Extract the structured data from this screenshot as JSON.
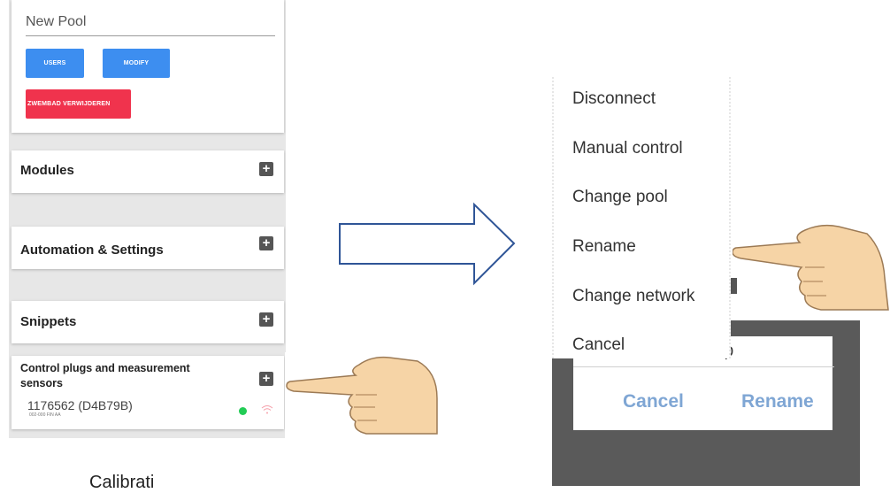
{
  "left_panel": {
    "pool": {
      "name": "New Pool",
      "users_button": "USERS",
      "modify_button": "MODIFY",
      "delete_button": "ZWEMBAD VERWIJDEREN"
    },
    "sections": [
      {
        "title": "Modules"
      },
      {
        "title": "Automation & Settings"
      },
      {
        "title": "Snippets"
      },
      {
        "title": "Control plugs and measurement sensors"
      }
    ],
    "device": {
      "name": "1176562 (D4B79B)",
      "subtitle": "002-000 FIN AA",
      "status_color": "#22cc55"
    }
  },
  "caption": "Calibrati",
  "right_panel": {
    "menu_items": [
      "Disconnect",
      "Manual control",
      "Change pool",
      "Rename",
      "Change network",
      "Cancel"
    ],
    "dialog": {
      "partial_text": "np",
      "cancel_label": "Cancel",
      "rename_label": "Rename"
    }
  },
  "colors": {
    "primary_button": "#3d8ef0",
    "danger_button": "#f0334d",
    "dialog_button": "#7fa6d4",
    "arrow_stroke": "#2f5597"
  }
}
